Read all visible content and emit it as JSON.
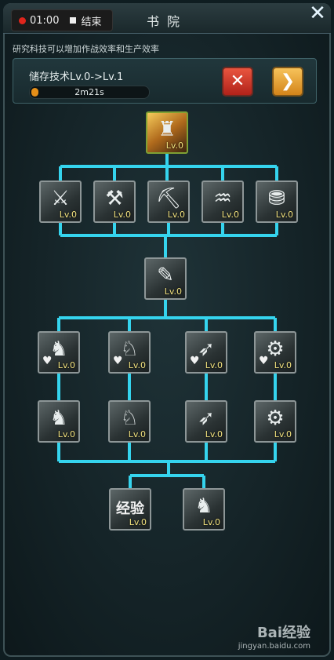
{
  "recorder": {
    "time": "01:00",
    "stop_label": "结束"
  },
  "header": {
    "title": "书院",
    "close_icon": "close-icon"
  },
  "subtitle": "研究科技可以增加作战效率和生产效率",
  "storage": {
    "title": "储存技术Lv.0->Lv.1",
    "timer": "2m21s",
    "progress": 0.06,
    "cancel_icon": "cancel-x-icon",
    "next_icon": "chevron-right-icon",
    "colors": {
      "cancel": "#d0342a",
      "next": "#eda83a",
      "progress": "#e58f18"
    }
  },
  "tree": {
    "line_color": "#35d4ee",
    "nodes": [
      {
        "name": "storage-tech",
        "icon": "castle-icon",
        "glyph": "♜",
        "level": "Lv.0",
        "active": true
      },
      {
        "name": "defense-tech",
        "icon": "axe-shield-icon",
        "glyph": "⚔",
        "level": "Lv.0"
      },
      {
        "name": "smithing-tech",
        "icon": "hammer-shield-icon",
        "glyph": "⚒",
        "level": "Lv.0"
      },
      {
        "name": "mining-tech",
        "icon": "pickaxe-icon",
        "glyph": "⛏",
        "level": "Lv.0"
      },
      {
        "name": "logging-tech",
        "icon": "saw-log-icon",
        "glyph": "♒",
        "level": "Lv.0"
      },
      {
        "name": "treasury-tech",
        "icon": "treasure-chest-icon",
        "glyph": "⛃",
        "level": "Lv.0"
      },
      {
        "name": "scroll-tech",
        "icon": "scroll-quill-icon",
        "glyph": "✎",
        "level": "Lv.0"
      },
      {
        "name": "infantry-health",
        "icon": "infantry-heart-icon",
        "glyph": "♞",
        "level": "Lv.0",
        "heart": true
      },
      {
        "name": "cavalry-health",
        "icon": "cavalry-heart-icon",
        "glyph": "♘",
        "level": "Lv.0",
        "heart": true
      },
      {
        "name": "archer-health",
        "icon": "archer-heart-icon",
        "glyph": "➶",
        "level": "Lv.0",
        "heart": true
      },
      {
        "name": "siege-health",
        "icon": "catapult-heart-icon",
        "glyph": "⚙",
        "level": "Lv.0",
        "heart": true
      },
      {
        "name": "infantry-attack",
        "icon": "infantry-sword-icon",
        "glyph": "♞",
        "level": "Lv.0"
      },
      {
        "name": "cavalry-attack",
        "icon": "cavalry-sword-icon",
        "glyph": "♘",
        "level": "Lv.0"
      },
      {
        "name": "archer-attack",
        "icon": "archer-sword-icon",
        "glyph": "➶",
        "level": "Lv.0"
      },
      {
        "name": "siege-attack",
        "icon": "catapult-sword-icon",
        "glyph": "⚙",
        "level": "Lv.0"
      },
      {
        "name": "experience-tech",
        "icon": "experience-icon",
        "word": "经验",
        "level": "Lv.0"
      },
      {
        "name": "horse-tech",
        "icon": "horse-icon",
        "glyph": "♞",
        "level": "Lv.0"
      }
    ]
  },
  "watermark": {
    "brand": "Bai经验",
    "url": "jingyan.baidu.com"
  }
}
